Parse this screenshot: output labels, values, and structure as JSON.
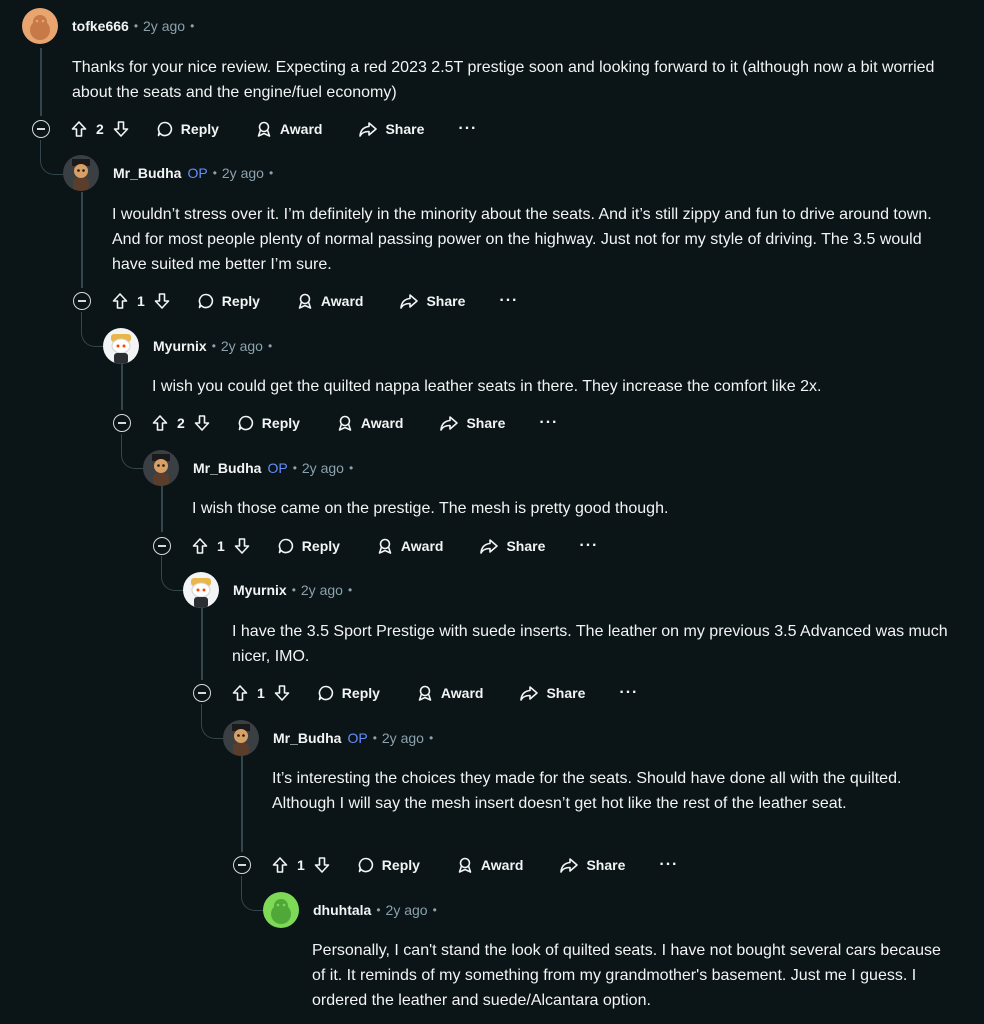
{
  "comments": [
    {
      "author": "tofke666",
      "op": "",
      "separator": "•",
      "age": "2y ago",
      "trailing": "•",
      "text": "Thanks for your nice review. Expecting a red 2023 2.5T prestige soon and looking forward to it (although now a bit worried about the seats and the engine/fuel economy)",
      "votes": "2"
    },
    {
      "author": "Mr_Budha",
      "op": "OP",
      "separator": "•",
      "age": "2y ago",
      "trailing": "•",
      "text": "I wouldn’t stress over it. I’m definitely in the minority about the seats. And it’s still zippy and fun to drive around town. And for most people plenty of normal passing power on the highway. Just not for my style of driving. The 3.5 would have suited me better I’m sure.",
      "votes": "1"
    },
    {
      "author": "Myurnix",
      "op": "",
      "separator": "•",
      "age": "2y ago",
      "trailing": "•",
      "text": "I wish you could get the quilted nappa leather seats in there. They increase the comfort like 2x.",
      "votes": "2"
    },
    {
      "author": "Mr_Budha",
      "op": "OP",
      "separator": "•",
      "age": "2y ago",
      "trailing": "•",
      "text": "I wish those came on the prestige. The mesh is pretty good though.",
      "votes": "1"
    },
    {
      "author": "Myurnix",
      "op": "",
      "separator": "•",
      "age": "2y ago",
      "trailing": "•",
      "text": "I have the 3.5 Sport Prestige with suede inserts. The leather on my previous 3.5 Advanced was much nicer, IMO.",
      "votes": "1"
    },
    {
      "author": "Mr_Budha",
      "op": "OP",
      "separator": "•",
      "age": "2y ago",
      "trailing": "•",
      "text": "It’s interesting the choices they made for the seats. Should have done all with the quilted. Although I will say the mesh insert doesn’t get hot like the rest of the leather seat.",
      "votes": "1"
    },
    {
      "author": "dhuhtala",
      "op": "",
      "separator": "•",
      "age": "2y ago",
      "trailing": "•",
      "text": "Personally, I can't stand the look of quilted seats. I have not bought several cars because of it. It reminds of my something from my grandmother's basement. Just me I guess. I ordered the leather and suede/Alcantara option.",
      "votes": ""
    }
  ],
  "actions": {
    "reply": "Reply",
    "award": "Award",
    "share": "Share",
    "more": "···"
  },
  "icons": {
    "upvote": "upvote-arrow-icon",
    "downvote": "downvote-arrow-icon",
    "reply": "speech-bubble-icon",
    "award": "award-ribbon-icon",
    "share": "share-arrow-icon",
    "collapse": "collapse-minus-icon"
  },
  "colors": {
    "background": "#0b1416",
    "text": "#f2f4f5",
    "meta": "#8ba2ad",
    "op": "#648efc",
    "thread_line": "#33464c",
    "avatar_orange": "#e8a56f",
    "avatar_green": "#7ed957"
  }
}
